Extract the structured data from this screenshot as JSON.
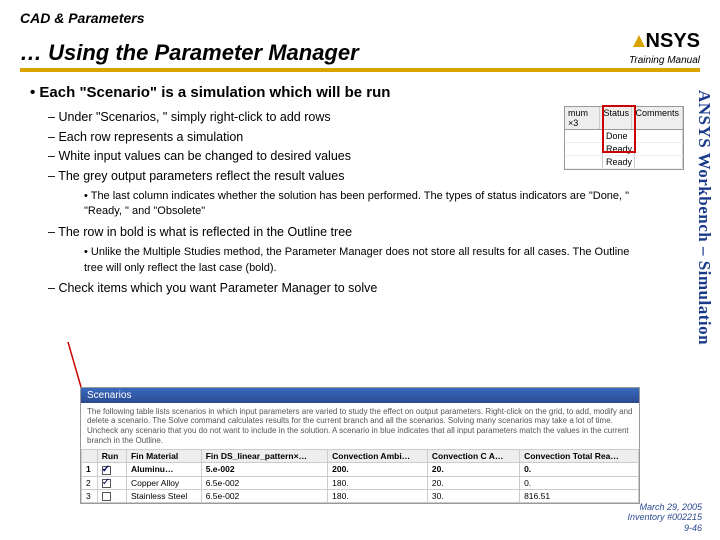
{
  "header": {
    "section": "CAD & Parameters",
    "title": "… Using the Parameter Manager",
    "logo_text": "NSYS",
    "manual": "Training Manual"
  },
  "side_text": "ANSYS Workbench – Simulation",
  "content": {
    "main": "Each \"Scenario\" is a simulation which will be run",
    "subs": [
      "Under \"Scenarios, \" simply right-click to add rows",
      "Each row represents a simulation",
      "White input values can be changed to desired values",
      "The grey output parameters reflect the result values"
    ],
    "subsub1": "The last column indicates whether the solution has been performed. The types of status indicators are \"Done, \" \"Ready, \" and \"Obsolete\"",
    "sub5": "The row in bold is what is reflected in the Outline tree",
    "subsub2": "Unlike the Multiple Studies method, the Parameter Manager does not store all results for all cases.  The Outline tree will only reflect the last case (bold).",
    "sub6": "Check items which you want Parameter Manager to solve"
  },
  "status_thumb": {
    "headers": [
      "mum ×3",
      "Status",
      "Comments"
    ],
    "rows": [
      [
        "",
        "Done",
        ""
      ],
      [
        "",
        "Ready",
        ""
      ],
      [
        "",
        "Ready",
        ""
      ]
    ]
  },
  "scenarios": {
    "title": "Scenarios",
    "desc": "The following table lists scenarios in which input parameters are varied to study the effect on output parameters. Right-click on the grid, to add, modify and delete a scenario. The Solve command calculates results for the current branch and all the scenarios. Solving many scenarios may take a lot of time. Uncheck any scenario that you do not want to include in the solution. A scenario in blue indicates that all input parameters match the values in the current branch in the Outline.",
    "headers": [
      "Run",
      "Fin Material",
      "Fin DS_linear_pattern×…",
      "Convection Ambi…",
      "Convection C A…",
      "Convection Total Rea…"
    ],
    "rows": [
      {
        "chk": true,
        "mat": "Aluminu…",
        "pat": "5.e-002",
        "amb": "200.",
        "ca": "20.",
        "tot": "0.",
        "bold": true
      },
      {
        "chk": true,
        "mat": "Copper Alloy",
        "pat": "6.5e-002",
        "amb": "180.",
        "ca": "20.",
        "tot": "0.",
        "bold": false
      },
      {
        "chk": false,
        "mat": "Stainless Steel",
        "pat": "6.5e-002",
        "amb": "180.",
        "ca": "30.",
        "tot": "816.51",
        "bold": false
      }
    ],
    "row_nums": [
      "1",
      "2",
      "3"
    ]
  },
  "footer": {
    "date": "March 29, 2005",
    "inv": "Inventory #002215",
    "page": "9-46"
  }
}
